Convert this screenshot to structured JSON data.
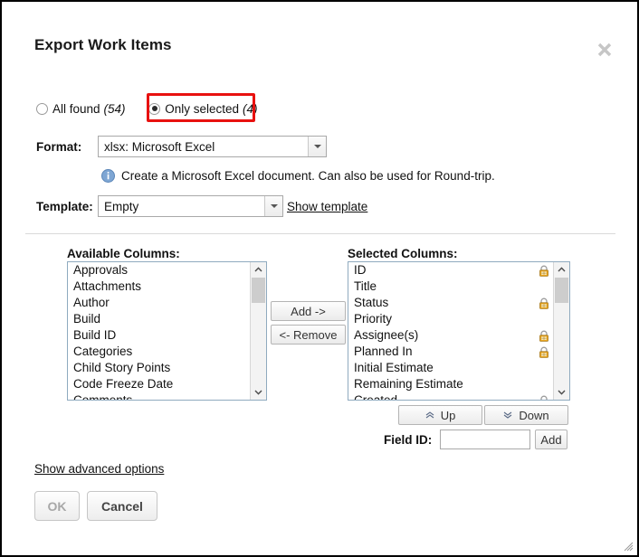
{
  "dialog": {
    "title": "Export Work Items",
    "close_icon": "close-icon"
  },
  "scope": {
    "all_found": {
      "label": "All found",
      "count": "(54)",
      "selected": false
    },
    "only_selected": {
      "label": "Only selected",
      "count": "(4)",
      "selected": true
    },
    "highlight_color": "#e8110f"
  },
  "format": {
    "label": "Format:",
    "value": "xlsx: Microsoft Excel",
    "info_icon": "info-icon",
    "info_text": "Create a Microsoft Excel document. Can also be used for Round-trip."
  },
  "template": {
    "label": "Template:",
    "value": "Empty",
    "show_link": "Show template"
  },
  "available": {
    "title": "Available Columns:",
    "items": [
      "Approvals",
      "Attachments",
      "Author",
      "Build",
      "Build ID",
      "Categories",
      "Child Story Points",
      "Code Freeze Date",
      "Comments"
    ]
  },
  "selected": {
    "title": "Selected Columns:",
    "items": [
      {
        "label": "ID",
        "locked": true
      },
      {
        "label": "Title",
        "locked": false
      },
      {
        "label": "Status",
        "locked": true
      },
      {
        "label": "Priority",
        "locked": false
      },
      {
        "label": "Assignee(s)",
        "locked": true
      },
      {
        "label": "Planned In",
        "locked": true
      },
      {
        "label": "Initial Estimate",
        "locked": false
      },
      {
        "label": "Remaining Estimate",
        "locked": false
      },
      {
        "label": "Created",
        "locked": true
      }
    ],
    "lock_icon": "lock-icon",
    "lock_color": "#e8a41c"
  },
  "transfer": {
    "add_label": "Add ->",
    "remove_label": "<- Remove"
  },
  "reorder": {
    "up_label": "Up",
    "down_label": "Down",
    "up_icon": "double-chevron-up-icon",
    "down_icon": "double-chevron-down-icon"
  },
  "field_id": {
    "label": "Field ID:",
    "value": "",
    "placeholder": "",
    "add_label": "Add"
  },
  "footer": {
    "advanced_link": "Show advanced options",
    "ok_label": "OK",
    "cancel_label": "Cancel"
  }
}
